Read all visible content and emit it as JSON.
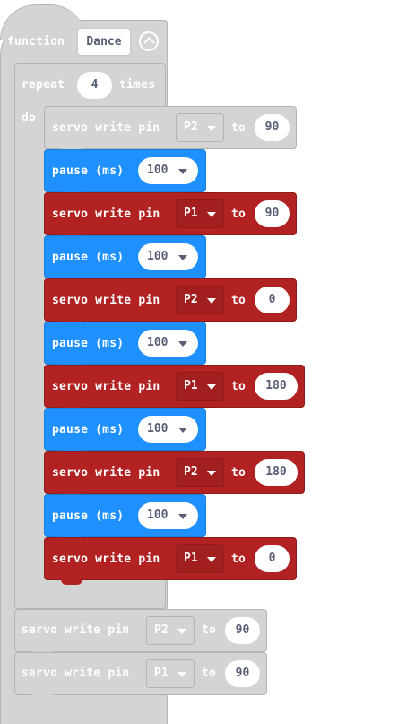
{
  "function_block": {
    "keyword": "function",
    "name": "Dance"
  },
  "repeat_block": {
    "keyword": "repeat",
    "count": "4",
    "times": "times",
    "do": "do"
  },
  "blocks": [
    {
      "kind": "servo",
      "label": "servo write pin",
      "pin": "P2",
      "to": "to",
      "value": "90",
      "disabled": true
    },
    {
      "kind": "pause",
      "label": "pause (ms)",
      "value": "100"
    },
    {
      "kind": "servo",
      "label": "servo write pin",
      "pin": "P1",
      "to": "to",
      "value": "90"
    },
    {
      "kind": "pause",
      "label": "pause (ms)",
      "value": "100"
    },
    {
      "kind": "servo",
      "label": "servo write pin",
      "pin": "P2",
      "to": "to",
      "value": "0"
    },
    {
      "kind": "pause",
      "label": "pause (ms)",
      "value": "100"
    },
    {
      "kind": "servo",
      "label": "servo write pin",
      "pin": "P1",
      "to": "to",
      "value": "180"
    },
    {
      "kind": "pause",
      "label": "pause (ms)",
      "value": "100"
    },
    {
      "kind": "servo",
      "label": "servo write pin",
      "pin": "P2",
      "to": "to",
      "value": "180"
    },
    {
      "kind": "pause",
      "label": "pause (ms)",
      "value": "100"
    },
    {
      "kind": "servo",
      "label": "servo write pin",
      "pin": "P1",
      "to": "to",
      "value": "0"
    }
  ],
  "after_blocks": [
    {
      "label": "servo write pin",
      "pin": "P2",
      "to": "to",
      "value": "90"
    },
    {
      "label": "servo write pin",
      "pin": "P1",
      "to": "to",
      "value": "90"
    }
  ],
  "colors": {
    "pause": "#1e90ff",
    "servo": "#b22222",
    "disabled": "#d4d4d4"
  }
}
